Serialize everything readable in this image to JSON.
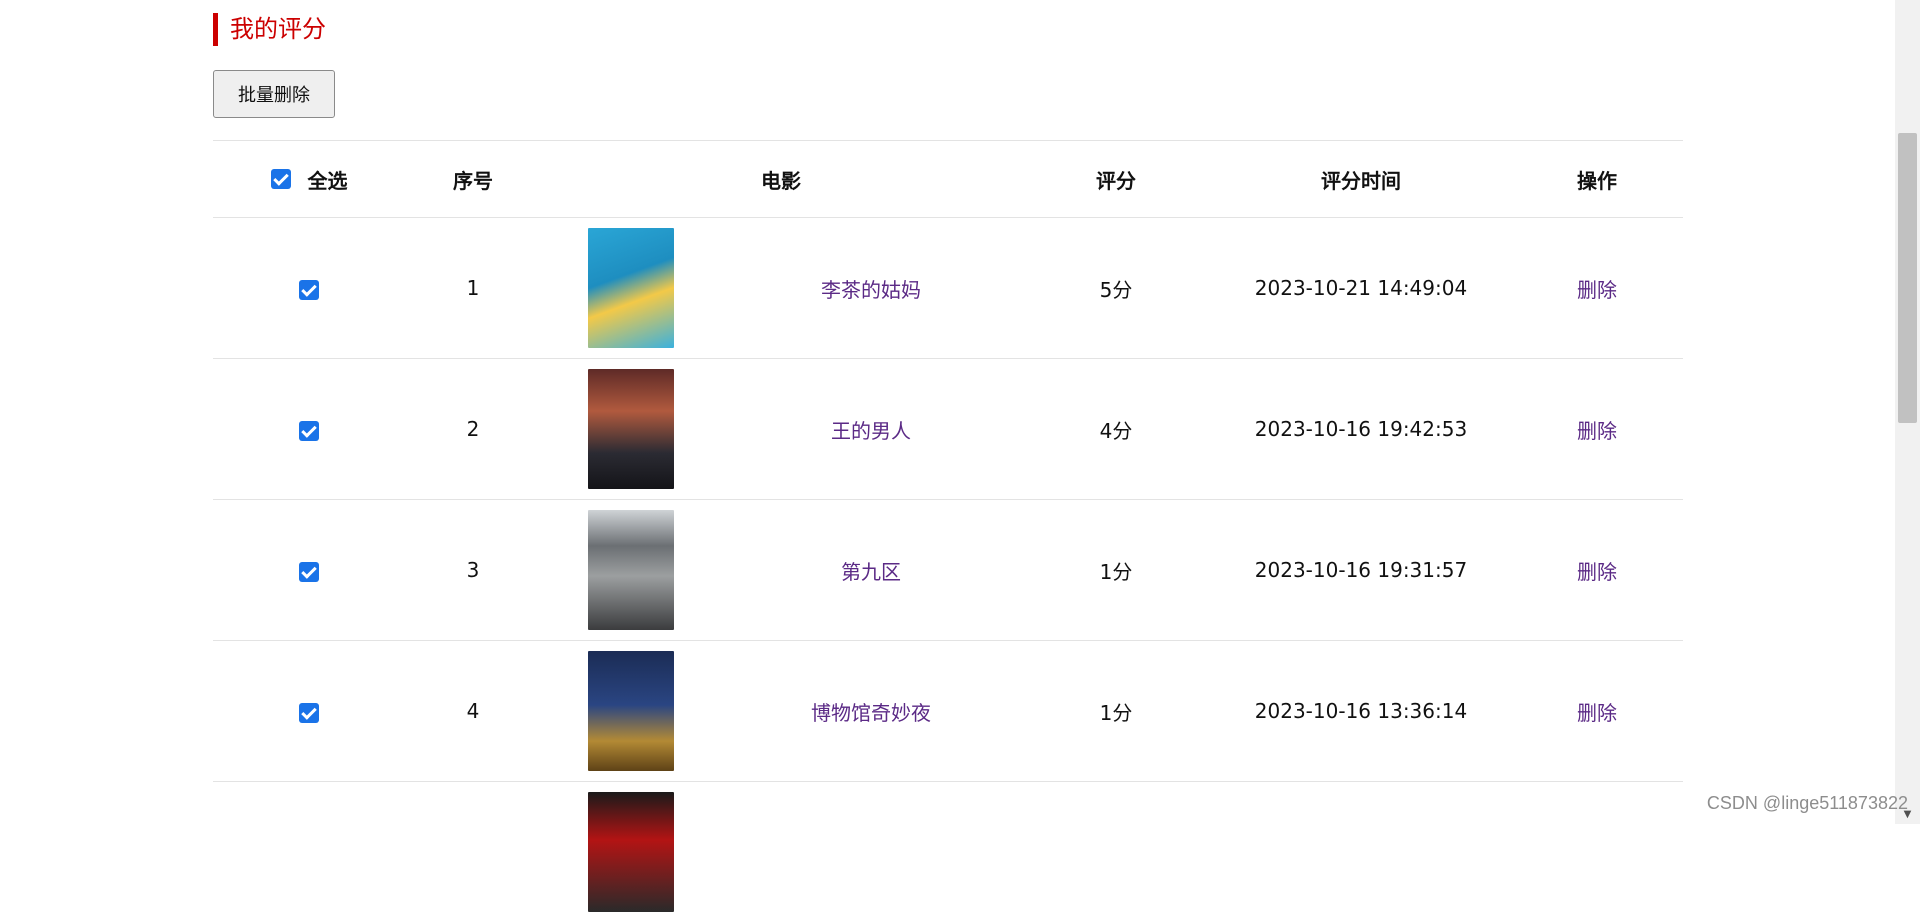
{
  "section": {
    "title": "我的评分"
  },
  "toolbar": {
    "batch_delete_label": "批量删除"
  },
  "table": {
    "headers": {
      "select_all": "全选",
      "index": "序号",
      "movie": "电影",
      "rating": "评分",
      "rated_at": "评分时间",
      "action": "操作"
    },
    "rows": [
      {
        "index": "1",
        "movie": "李茶的姑妈",
        "rating": "5分",
        "rated_at": "2023-10-21 14:49:04",
        "action": "删除",
        "checked": true
      },
      {
        "index": "2",
        "movie": "王的男人",
        "rating": "4分",
        "rated_at": "2023-10-16 19:42:53",
        "action": "删除",
        "checked": true
      },
      {
        "index": "3",
        "movie": "第九区",
        "rating": "1分",
        "rated_at": "2023-10-16 19:31:57",
        "action": "删除",
        "checked": true
      },
      {
        "index": "4",
        "movie": "博物馆奇妙夜",
        "rating": "1分",
        "rated_at": "2023-10-16 13:36:14",
        "action": "删除",
        "checked": true
      }
    ]
  },
  "watermark": "CSDN @linge511873822",
  "colors": {
    "accent_red": "#cc0000",
    "link_purple": "#5b2a86",
    "checkbox_blue": "#1a73e8"
  },
  "icons": {
    "checkbox": "checked-checkbox-icon",
    "scroll_down": "chevron-down-icon"
  }
}
